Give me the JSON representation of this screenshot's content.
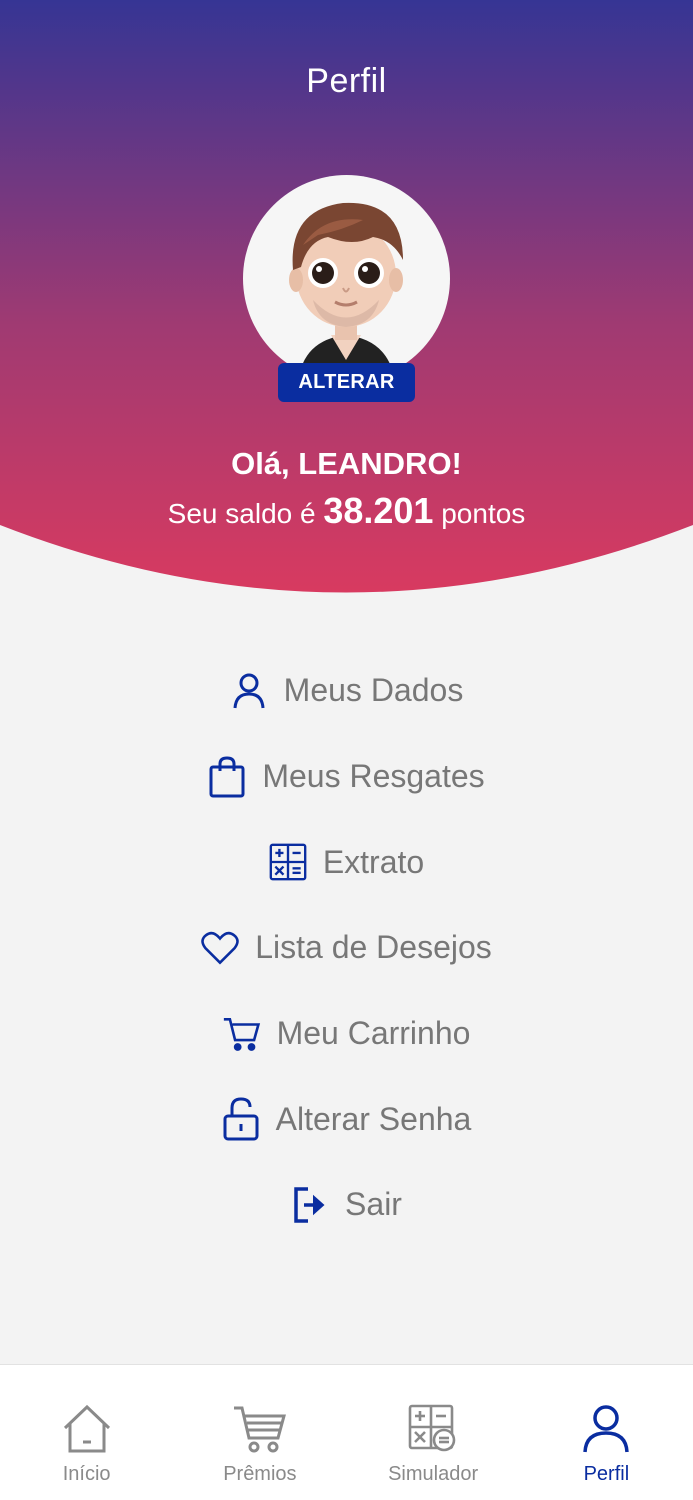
{
  "header": {
    "title": "Perfil",
    "change_avatar_label": "ALTERAR",
    "greeting": "Olá, LEANDRO!",
    "balance_prefix": "Seu saldo é",
    "balance_points": "38.201",
    "balance_suffix": "pontos",
    "gradient_top": "#363594",
    "gradient_bottom": "#d83a60"
  },
  "menu": {
    "items": [
      {
        "label": "Meus Dados",
        "icon": "user-icon"
      },
      {
        "label": "Meus Resgates",
        "icon": "shopping-bag-icon"
      },
      {
        "label": "Extrato",
        "icon": "calculator-icon"
      },
      {
        "label": "Lista de Desejos",
        "icon": "heart-icon"
      },
      {
        "label": "Meu Carrinho",
        "icon": "cart-icon"
      },
      {
        "label": "Alterar Senha",
        "icon": "unlock-icon"
      },
      {
        "label": "Sair",
        "icon": "logout-icon"
      }
    ],
    "icon_color": "#0a2da0",
    "text_color": "#777777"
  },
  "bottom_nav": {
    "items": [
      {
        "label": "Início",
        "icon": "home-icon",
        "active": false
      },
      {
        "label": "Prêmios",
        "icon": "cart-icon",
        "active": false
      },
      {
        "label": "Simulador",
        "icon": "calculator-icon",
        "active": false
      },
      {
        "label": "Perfil",
        "icon": "user-icon",
        "active": true
      }
    ],
    "active_color": "#0a2da0",
    "inactive_color": "#8a8a8a"
  }
}
